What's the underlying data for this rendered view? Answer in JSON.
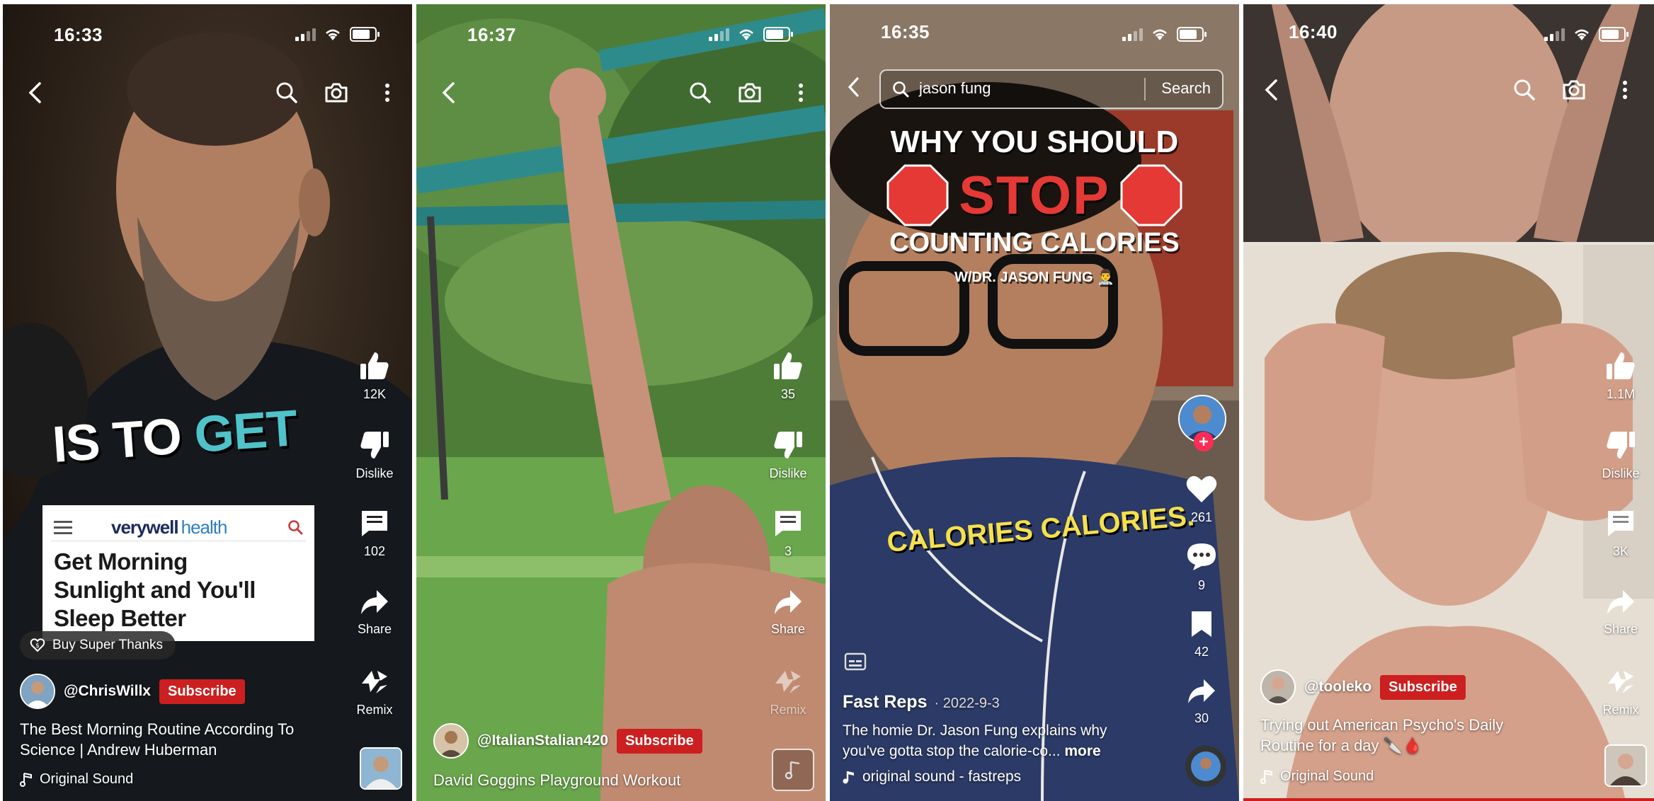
{
  "phones": [
    {
      "time": "16:33",
      "overlay_text": [
        "IS TO ",
        "GET"
      ],
      "ad": {
        "brand_a": "verywell",
        "brand_b": "health",
        "headline_lines": [
          "Get Morning",
          "Sunlight and You'll",
          "Sleep Better"
        ]
      },
      "super_thanks": "Buy Super Thanks",
      "likes": "12K",
      "dislike": "Dislike",
      "comments": "102",
      "share": "Share",
      "remix": "Remix",
      "handle": "@ChrisWillx",
      "subscribe": "Subscribe",
      "caption": [
        "The Best Morning Routine According To",
        "Science | Andrew Huberman"
      ],
      "sound": "Original Sound"
    },
    {
      "time": "16:37",
      "likes": "35",
      "dislike": "Dislike",
      "comments": "3",
      "share": "Share",
      "remix": "Remix",
      "handle": "@ItalianStalian420",
      "subscribe": "Subscribe",
      "caption": [
        "David Goggins Playground Workout"
      ]
    },
    {
      "time": "16:35",
      "search": {
        "value": "jason fung",
        "button": "Search"
      },
      "headline_1": "WHY YOU SHOULD",
      "headline_stop": "STOP",
      "headline_2": "COUNTING CALORIES",
      "headline_3": "W/DR. JASON FUNG 👨‍⚕️",
      "subtitle": "CALORIES CALORIES.",
      "likes": "261",
      "comments": "9",
      "saves": "42",
      "shares": "30",
      "author": "Fast Reps",
      "date": "· 2022-9-3",
      "caption": [
        "The homie Dr. Jason Fung explains why",
        "you've gotta stop the calorie-co..."
      ],
      "more": "more",
      "sound": "original sound - fastreps"
    },
    {
      "time": "16:40",
      "likes": "1.1M",
      "dislike": "Dislike",
      "comments": "3K",
      "share": "Share",
      "remix": "Remix",
      "handle": "@tooleko",
      "subscribe": "Subscribe",
      "caption": [
        "Trying out American Psycho's Daily",
        "Routine for a day 🔪🩸"
      ],
      "sound": "Original Sound"
    }
  ],
  "colors": {
    "subscribe_red": "#cc1f1f",
    "accent_teal": "#4fc3c9",
    "stop_red": "#e53935",
    "caption_yellow": "#f4e04d",
    "tiktok_pink": "#fe2c55"
  }
}
